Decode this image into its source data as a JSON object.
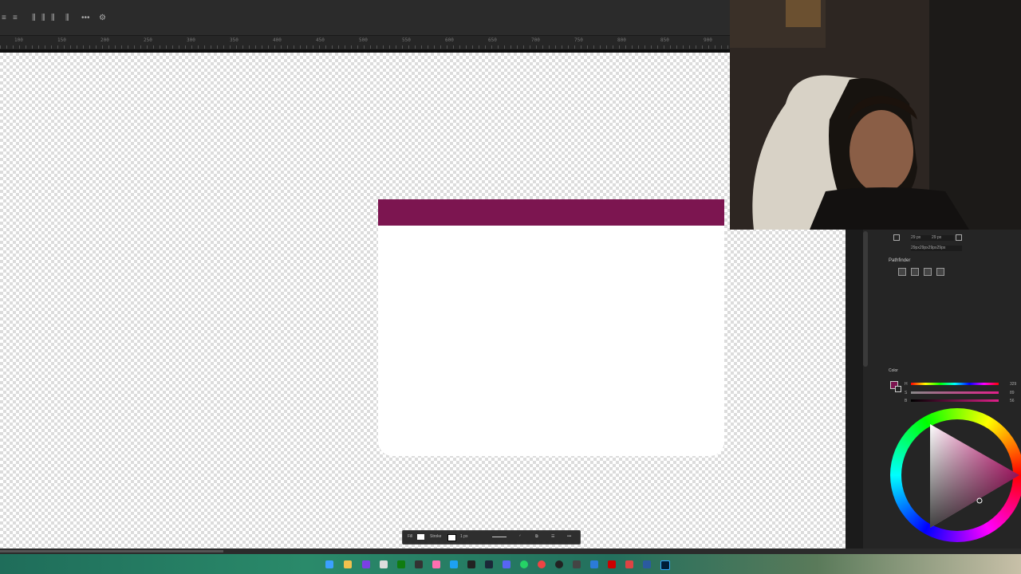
{
  "optbar": {
    "more_label": "•••"
  },
  "ruler": {
    "labels": [
      "100",
      "150",
      "200",
      "250",
      "300",
      "350",
      "400",
      "450",
      "500",
      "550",
      "600",
      "650",
      "700",
      "750",
      "800",
      "850",
      "900"
    ]
  },
  "properties": {
    "w_value": "29 px",
    "h_value": "29 px",
    "corner_value": "29px29px29px29px",
    "pathfinder_title": "Pathfinder"
  },
  "color_panel": {
    "title": "Color",
    "h_label": "H",
    "h_value": "329",
    "s_label": "S",
    "s_value": "89",
    "b_label": "B",
    "b_value": "56",
    "fill_color": "#7c1550"
  },
  "canvas": {
    "shape_header_color": "#7c1550",
    "shape_body_color": "#ffffff"
  },
  "floating_toolbar": {
    "fill_label": "Fill",
    "stroke_label": "Stroke",
    "stroke_width": "1 px"
  },
  "icons": [
    "align-icon",
    "distribute-icon",
    "more-icon",
    "gear-icon",
    "windows-icon",
    "file-explorer-icon",
    "chrome-icon",
    "steam-icon",
    "discord-icon",
    "whatsapp-icon",
    "photoshop-icon"
  ]
}
